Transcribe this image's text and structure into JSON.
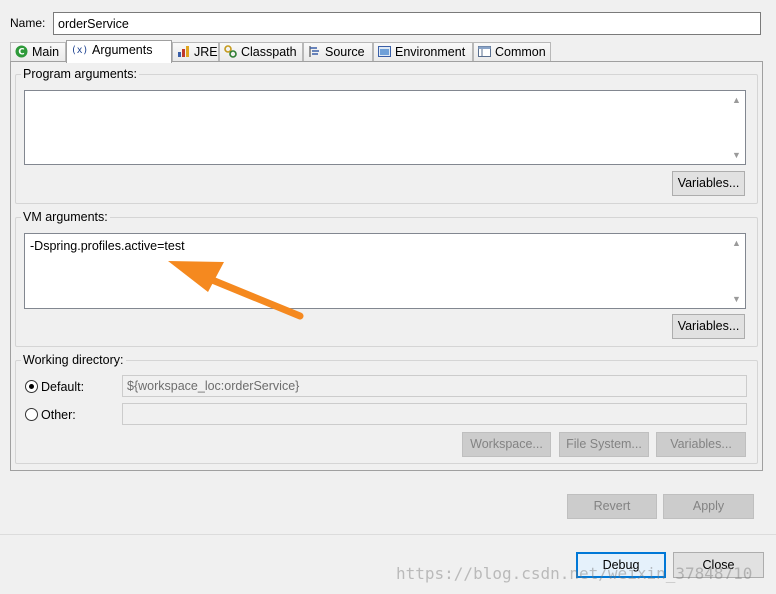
{
  "name_field": {
    "label": "Name:",
    "value": "orderService"
  },
  "tabs": [
    {
      "label": "Main",
      "icon": "main-config-icon"
    },
    {
      "label": "Arguments",
      "icon": "arguments-icon"
    },
    {
      "label": "JRE",
      "icon": "jre-icon"
    },
    {
      "label": "Classpath",
      "icon": "classpath-icon"
    },
    {
      "label": "Source",
      "icon": "source-icon"
    },
    {
      "label": "Environment",
      "icon": "environment-icon"
    },
    {
      "label": "Common",
      "icon": "common-icon"
    }
  ],
  "program_arguments": {
    "title": "Program arguments:",
    "value": "",
    "variables_label": "Variables..."
  },
  "vm_arguments": {
    "title": "VM arguments:",
    "value": "-Dspring.profiles.active=test",
    "variables_label": "Variables..."
  },
  "working_directory": {
    "title": "Working directory:",
    "default_label": "Default:",
    "default_value": "${workspace_loc:orderService}",
    "default_selected": true,
    "other_label": "Other:",
    "other_value": "",
    "workspace_label": "Workspace...",
    "filesystem_label": "File System...",
    "variables_label": "Variables..."
  },
  "actions": {
    "revert_label": "Revert",
    "apply_label": "Apply"
  },
  "dialog_buttons": {
    "debug_label": "Debug",
    "close_label": "Close"
  },
  "watermark": "https://blog.csdn.net/weixin_37848710",
  "colors": {
    "annotation_arrow": "#f5891f",
    "default_button_border": "#0078d7"
  }
}
